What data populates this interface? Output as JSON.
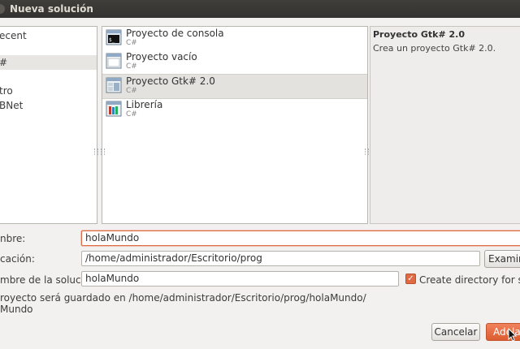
{
  "window": {
    "title": "Nueva solución"
  },
  "categories": [
    {
      "label": "ecent",
      "selected": false
    },
    {
      "label": "#",
      "selected": true
    },
    {
      "label": "tro",
      "selected": false
    },
    {
      "label": "BNet",
      "selected": false
    }
  ],
  "templates": [
    {
      "name": "Proyecto de consola",
      "lang": "C#",
      "icon": "console-project-icon",
      "selected": false
    },
    {
      "name": "Proyecto vacío",
      "lang": "C#",
      "icon": "empty-project-icon",
      "selected": false
    },
    {
      "name": "Proyecto Gtk# 2.0",
      "lang": "C#",
      "icon": "gtk-project-icon",
      "selected": true
    },
    {
      "name": "Librería",
      "lang": "C#",
      "icon": "library-icon",
      "selected": false
    }
  ],
  "description": {
    "title": "Proyecto Gtk# 2.0",
    "text": "Crea un proyecto Gtk# 2.0."
  },
  "form": {
    "name_label": "nbre:",
    "name_value": "holaMundo",
    "location_label": "cación:",
    "location_value": "/home/administrador/Escritorio/prog",
    "browse_label": "Examinar",
    "solution_label": "mbre de la solución:",
    "solution_value": "holaMundo",
    "create_dir_label": "Create directory for solution",
    "create_dir_checked": true
  },
  "info": {
    "line1": "royecto será guardado en /home/administrador/Escritorio/prog/holaMundo/",
    "line2": "Mundo"
  },
  "buttons": {
    "cancel": "Cancelar",
    "forward": "Adelante"
  },
  "colors": {
    "accent": "#e06a43",
    "titlebar": "#3c3b37"
  }
}
